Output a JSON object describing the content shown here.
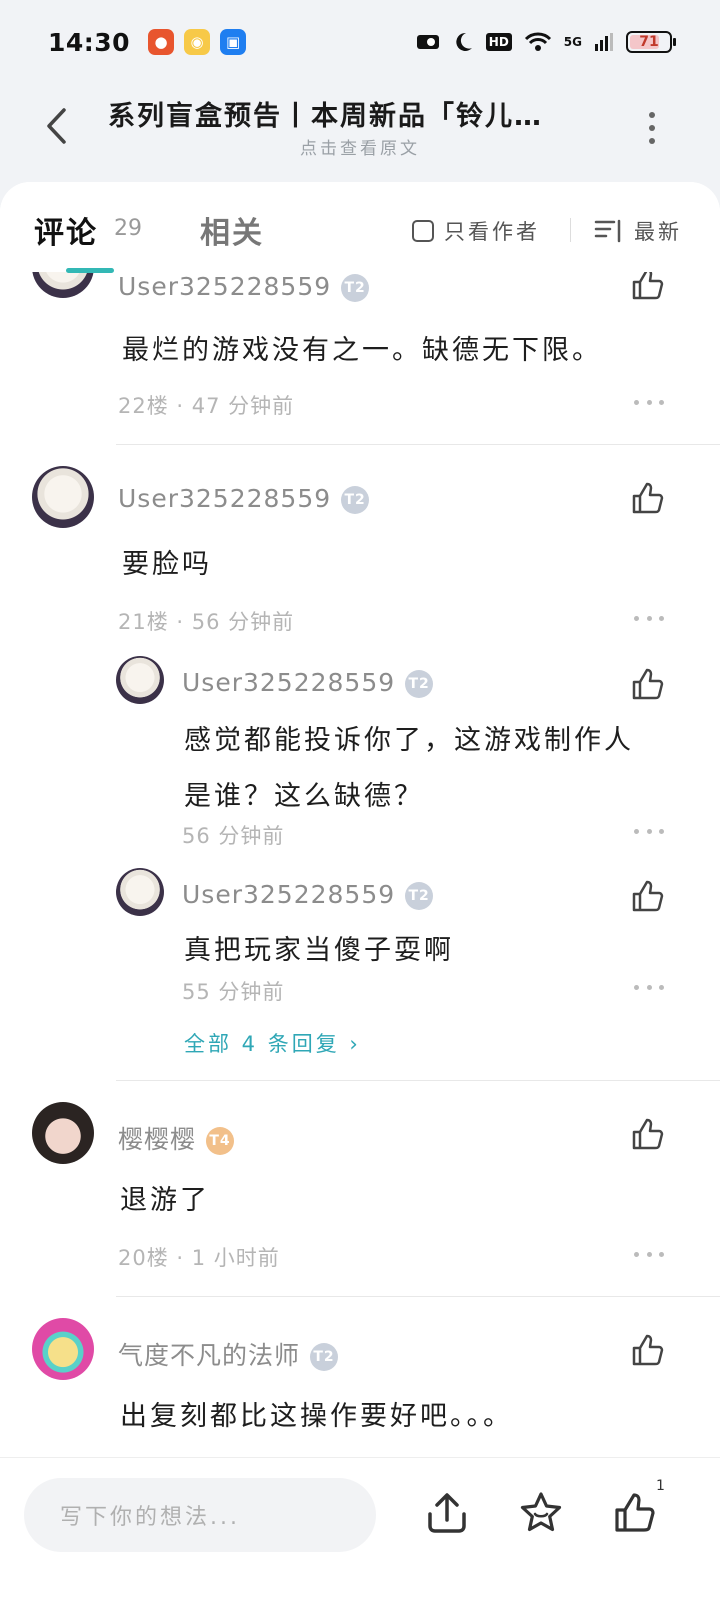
{
  "status_bar": {
    "time": "14:30",
    "battery": "71",
    "network": "5G",
    "hd": "HD"
  },
  "header": {
    "title": "系列盲盒预告丨本周新品「铃儿…",
    "subtitle": "点击查看原文"
  },
  "tabs": {
    "comments_label": "评论",
    "comments_count": "29",
    "related_label": "相关",
    "only_author_label": "只看作者",
    "sort_label": "最新"
  },
  "comments": [
    {
      "user": "User325228559",
      "badge": "T2",
      "text": "最烂的游戏没有之一。缺德无下限。",
      "meta": "22楼 · 47 分钟前"
    },
    {
      "user": "User325228559",
      "badge": "T2",
      "text": "要脸吗",
      "meta": "21楼 · 56 分钟前",
      "replies": [
        {
          "user": "User325228559",
          "badge": "T2",
          "text_line1": "感觉都能投诉你了，这游戏制作人",
          "text_line2": "是谁？这么缺德？",
          "meta": "56 分钟前"
        },
        {
          "user": "User325228559",
          "badge": "T2",
          "text": "真把玩家当傻子耍啊",
          "meta": "55 分钟前"
        }
      ],
      "all_replies_label": "全部 4 条回复"
    },
    {
      "user": "樱樱樱",
      "badge": "T4",
      "text": "退游了",
      "meta": "20楼 · 1 小时前"
    },
    {
      "user": "气度不凡的法师",
      "badge": "T2",
      "text": "出复刻都比这操作要好吧。。。"
    }
  ],
  "bottom_bar": {
    "input_placeholder": "写下你的想法...",
    "like_count": "1"
  },
  "colors": {
    "accent": "#33b8b5",
    "link": "#2fa7b6",
    "background": "#f1f3f6"
  },
  "icons": [
    "back-arrow-icon",
    "more-vertical-icon",
    "checkbox-icon",
    "sort-list-icon",
    "thumbs-up-icon",
    "ellipsis-icon",
    "share-icon",
    "star-icon"
  ]
}
